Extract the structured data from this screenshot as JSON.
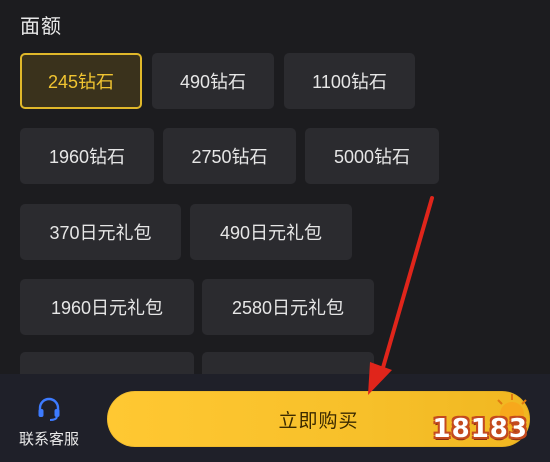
{
  "section": {
    "title": "面额"
  },
  "options": [
    {
      "label": "245钻石",
      "selected": true
    },
    {
      "label": "490钻石",
      "selected": false
    },
    {
      "label": "1100钻石",
      "selected": false
    },
    {
      "label": "1960钻石",
      "selected": false
    },
    {
      "label": "2750钻石",
      "selected": false
    },
    {
      "label": "5000钻石",
      "selected": false
    },
    {
      "label": "370日元礼包",
      "selected": false
    },
    {
      "label": "490日元礼包",
      "selected": false
    },
    {
      "label": "1960日元礼包",
      "selected": false
    },
    {
      "label": "2580日元礼包",
      "selected": false
    }
  ],
  "footer": {
    "service_label": "联系客服",
    "service_icon": "headset-icon",
    "buy_label": "立即购买"
  },
  "watermark": {
    "text": "18183"
  },
  "colors": {
    "background": "#1c1c1f",
    "option_bg": "#2b2b2f",
    "selected_border": "#e0b82a",
    "selected_text": "#f0c431",
    "buy_button": "#f7c02a",
    "arrow": "#e0251b"
  }
}
